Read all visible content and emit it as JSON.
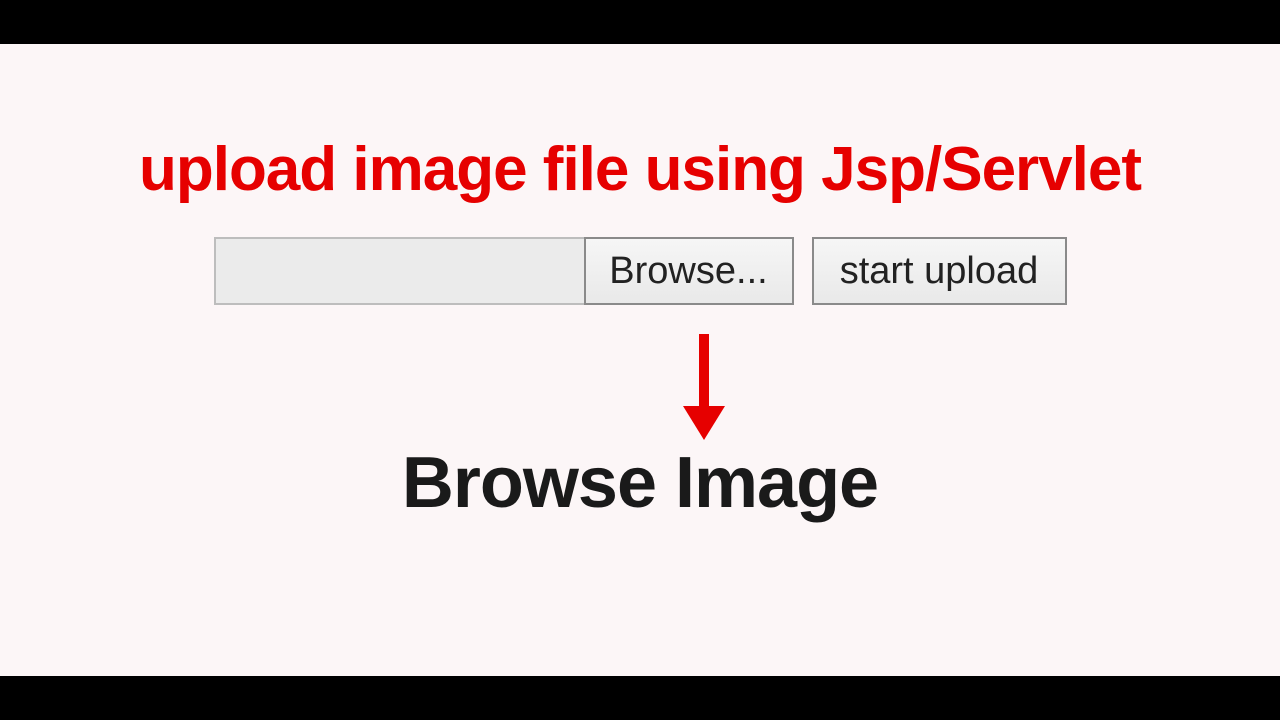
{
  "title": "upload image file using Jsp/Servlet",
  "file_input_value": "",
  "browse_label": "Browse...",
  "upload_label": "start upload",
  "subtitle": "Browse Image"
}
